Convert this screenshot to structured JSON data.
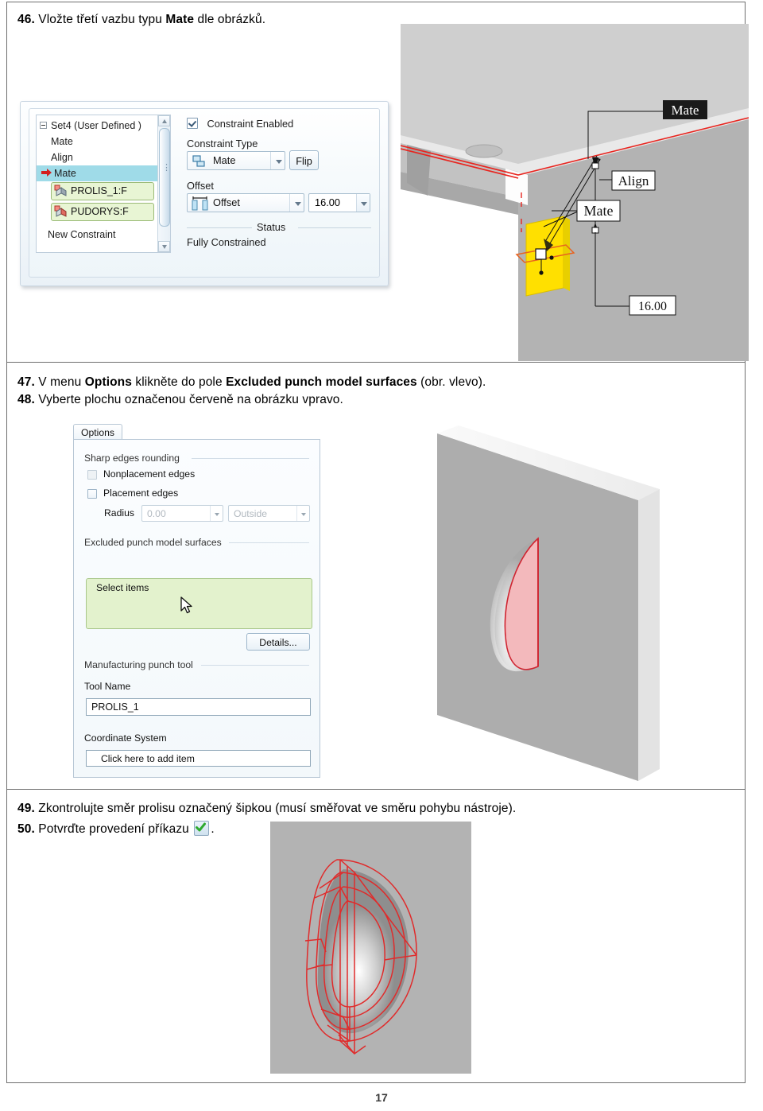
{
  "page": {
    "number": "17"
  },
  "steps": [
    {
      "id": "46",
      "num": "46.",
      "text_parts": [
        {
          "t": "Vložte třetí vazbu typu ",
          "b": false
        },
        {
          "t": "Mate",
          "b": true
        },
        {
          "t": " dle obrázků.",
          "b": false
        }
      ]
    },
    {
      "id": "47",
      "num": "47.",
      "text_parts": [
        {
          "t": "V menu ",
          "b": false
        },
        {
          "t": "Options",
          "b": true
        },
        {
          "t": " klikněte do pole ",
          "b": false
        },
        {
          "t": "Excluded punch model surfaces",
          "b": true
        },
        {
          "t": " (obr. vlevo).",
          "b": false
        }
      ]
    },
    {
      "id": "48",
      "num": "48.",
      "text_parts": [
        {
          "t": "Vyberte plochu označenou červeně na obrázku vpravo.",
          "b": false
        }
      ]
    },
    {
      "id": "49",
      "num": "49.",
      "text_parts": [
        {
          "t": "Zkontrolujte směr prolisu označený šipkou (musí směřovat ve směru pohybu nástroje).",
          "b": false
        }
      ]
    },
    {
      "id": "50",
      "num": "50.",
      "text_parts": [
        {
          "t": "Potvrďte provedení příkazu ",
          "b": false
        },
        {
          "t": "[check-icon]",
          "b": false
        },
        {
          "t": ".",
          "b": false
        }
      ]
    }
  ],
  "constraint_dialog": {
    "tree": {
      "root": "Set4 (User Defined )",
      "items": [
        "Mate",
        "Align",
        "Mate"
      ],
      "selected_index": 2,
      "chips": [
        "PROLIS_1:F",
        "PUDORYS:F"
      ],
      "footer": "New Constraint"
    },
    "constraint_enabled_label": "Constraint Enabled",
    "constraint_enabled_checked": true,
    "constraint_type_label": "Constraint Type",
    "constraint_type_value": "Mate",
    "flip_label": "Flip",
    "offset_group_label": "Offset",
    "offset_type_value": "Offset",
    "offset_value": "16.00",
    "status_label": "Status",
    "status_value": "Fully Constrained"
  },
  "options_dialog": {
    "tab_label": "Options",
    "group_sharp_edges": "Sharp edges rounding",
    "chk_nonplacement": "Nonplacement edges",
    "chk_placement": "Placement edges",
    "radius_label": "Radius",
    "radius_value": "0.00",
    "side_value": "Outside",
    "group_excluded": "Excluded punch model surfaces",
    "select_items_label": "Select items",
    "details_label": "Details...",
    "group_manufacturing": "Manufacturing punch tool",
    "tool_name_label": "Tool Name",
    "tool_name_value": "PROLIS_1",
    "coord_sys_label": "Coordinate System",
    "coord_sys_value": "Click here to add item"
  },
  "assembly_figure": {
    "callouts": [
      {
        "label": "Mate",
        "style": "dark"
      },
      {
        "label": "Align",
        "style": "light"
      },
      {
        "label": "Mate",
        "style": "light"
      },
      {
        "label": "16.00",
        "style": "light"
      }
    ]
  },
  "colors": {
    "highlight_red": "#e8251f",
    "selection_blue": "#9fdbe8",
    "chip_green": "#e8f5d4",
    "select_green": "#e3f2cd",
    "yellow_face": "#ffe000",
    "pink_face": "#f3b9bc"
  }
}
